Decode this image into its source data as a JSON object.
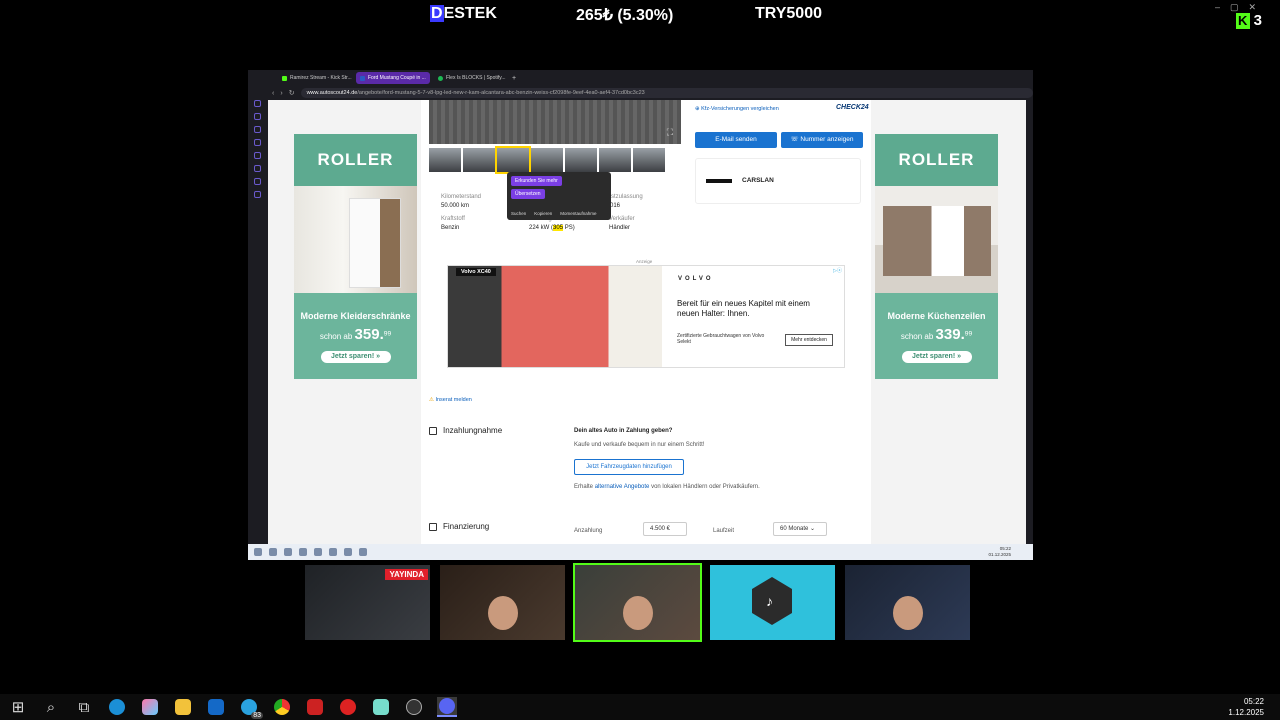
{
  "overlay": {
    "destek_first": "D",
    "destek_rest": "ESTEK",
    "donation_amount": "265₺ (5.30%)",
    "goal": "TRY5000",
    "kick_count": "3",
    "kick_letter": "K"
  },
  "browser": {
    "tabs": [
      {
        "label": "Ramirez Stream - Kick Str..."
      },
      {
        "label": "Ford Mustang Coupé in ..."
      },
      {
        "label": "Flex Is BLOCKS | Spotify..."
      }
    ],
    "url_host": "www.autoscout24.de",
    "url_path": "/angebote/ford-mustang-5-7-v8-lpg-led-new-r-kam-alcantara-abc-benzin-weiss-cf2098fe-9eef-4ea0-aef4-37cd0bc3c23"
  },
  "listing": {
    "check24_link": "Kfz-Versicherungen vergleichen",
    "check24_logo": "CHECK24",
    "email_button": "E-Mail senden",
    "phone_button": "Nummer anzeigen",
    "dealer_name": "CARSLAN",
    "specs": [
      {
        "label": "Kilometerstand",
        "value": "50.000 km"
      },
      {
        "label": "Erstzulassung",
        "value": "/2016"
      },
      {
        "label": "Kraftstoff",
        "value": "Benzin"
      },
      {
        "label": "Leistung",
        "value_pre": "224 kW (",
        "value_mark": "305",
        "value_post": " PS)"
      },
      {
        "label": "Verkäufer",
        "value": "Händler"
      }
    ],
    "tooltip": {
      "ask": "Erkunden Sie mehr",
      "translate": "Übersetzen",
      "menu": [
        "Suchen",
        "Kopieren",
        "Momentaufnahme"
      ]
    }
  },
  "ads": {
    "left": {
      "brand": "ROLLER",
      "title": "Moderne Kleiderschränke",
      "price_prefix": "schon ab",
      "price": "359.",
      "price_cents": "99",
      "cta": "Jetzt sparen!  »"
    },
    "right": {
      "brand": "ROLLER",
      "title": "Moderne Küchenzeilen",
      "price_prefix": "schon ab",
      "price": "339.",
      "price_cents": "99",
      "cta": "Jetzt sparen!  »"
    },
    "anzeige": "Anzeige",
    "volvo": {
      "tag": "Volvo XC40",
      "logo": "VOLVO",
      "headline": "Bereit für ein neues Kapitel mit einem neuen Halter: Ihnen.",
      "sub": "Zertifizierte Gebrauchtwagen von Volvo Selekt",
      "cta": "Mehr entdecken"
    }
  },
  "report_link": "Inserat melden",
  "tradein": {
    "title": "Inzahlungnahme",
    "question": "Dein altes Auto in Zahlung geben?",
    "sub": "Kaufe und verkaufe bequem in nur einem Schritt!",
    "button": "Jetzt Fahrzeugdaten hinzufügen",
    "alt_pre": "Erhalte ",
    "alt_link": "alternative Angebote",
    "alt_post": " von lokalen Händlern oder Privatkäufern."
  },
  "financing": {
    "title": "Finanzierung",
    "down_label": "Anzahlung",
    "down_value": "4.500     €",
    "term_label": "Laufzeit",
    "term_value": "60 Monate  ⌄"
  },
  "inner_clock": {
    "time": "05:22",
    "date": "01.12.2025"
  },
  "cams": {
    "live_badge": "YAYINDA"
  },
  "taskbar": {
    "telegram_badge": "83",
    "clock_time": "05:22",
    "clock_date": "1.12.2025"
  }
}
